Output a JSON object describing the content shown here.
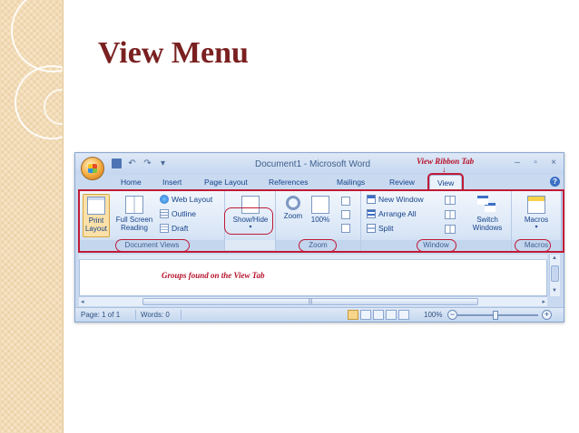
{
  "slide": {
    "title": "View Menu"
  },
  "window": {
    "title": "Document1 - Microsoft Word",
    "controls": {
      "minimize": "–",
      "restore": "▫",
      "close": "×"
    }
  },
  "annotations": {
    "ribbon_tab": "View Ribbon Tab",
    "groups": "Groups found on the View Tab"
  },
  "tabs": [
    {
      "label": "Home"
    },
    {
      "label": "Insert"
    },
    {
      "label": "Page Layout"
    },
    {
      "label": "References"
    },
    {
      "label": "Mailings"
    },
    {
      "label": "Review"
    },
    {
      "label": "View",
      "active": true
    }
  ],
  "ribbon": {
    "document_views": {
      "label": "Document Views",
      "print_layout": "Print Layout",
      "full_screen_reading": "Full Screen Reading",
      "web_layout": "Web Layout",
      "outline": "Outline",
      "draft": "Draft"
    },
    "show_hide": {
      "label": "Show/Hide"
    },
    "zoom": {
      "label": "Zoom",
      "zoom": "Zoom",
      "hundred": "100%"
    },
    "window": {
      "label": "Window",
      "new_window": "New Window",
      "arrange_all": "Arrange All",
      "split": "Split",
      "switch_windows": "Switch Windows"
    },
    "macros": {
      "label": "Macros",
      "macros": "Macros"
    }
  },
  "status": {
    "page": "Page: 1 of 1",
    "words": "Words: 0",
    "zoom": "100%"
  },
  "icons": [
    "office-button-icon",
    "save-icon",
    "undo-icon",
    "redo-icon",
    "help-icon"
  ],
  "colors": {
    "annotation": "#c01a36",
    "title": "#7a2020",
    "ribbon": "#dbe7f6"
  }
}
